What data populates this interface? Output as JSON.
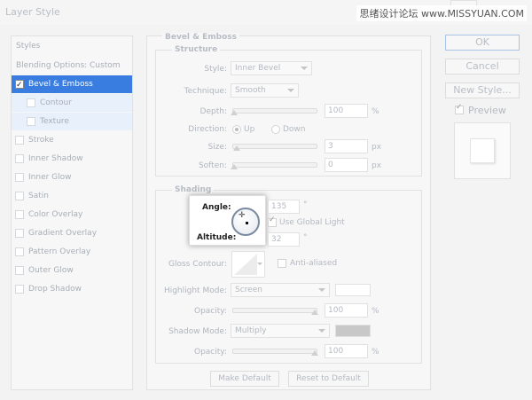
{
  "window": {
    "title": "Layer Style",
    "watermark": "思绪设计论坛 www.MISSYUAN.COM"
  },
  "styles_panel": {
    "items": [
      {
        "label": "Styles"
      },
      {
        "label": "Blending Options: Custom"
      },
      {
        "label": "Bevel & Emboss",
        "checked": true,
        "selected": true
      },
      {
        "label": "Contour"
      },
      {
        "label": "Texture"
      },
      {
        "label": "Stroke"
      },
      {
        "label": "Inner Shadow"
      },
      {
        "label": "Inner Glow"
      },
      {
        "label": "Satin"
      },
      {
        "label": "Color Overlay"
      },
      {
        "label": "Gradient Overlay"
      },
      {
        "label": "Pattern Overlay"
      },
      {
        "label": "Outer Glow"
      },
      {
        "label": "Drop Shadow"
      }
    ]
  },
  "bevel": {
    "title": "Bevel & Emboss",
    "structure": {
      "title": "Structure",
      "style_label": "Style:",
      "style_value": "Inner Bevel",
      "technique_label": "Technique:",
      "technique_value": "Smooth",
      "depth_label": "Depth:",
      "depth_value": "100",
      "depth_unit": "%",
      "direction_label": "Direction:",
      "direction_up": "Up",
      "direction_down": "Down",
      "size_label": "Size:",
      "size_value": "3",
      "size_unit": "px",
      "soften_label": "Soften:",
      "soften_value": "0",
      "soften_unit": "px"
    },
    "shading": {
      "title": "Shading",
      "angle_label": "Angle:",
      "angle_value": "135",
      "angle_unit": "°",
      "use_global_light": "Use Global Light",
      "altitude_label": "Altitude:",
      "altitude_value": "32",
      "altitude_unit": "°",
      "gloss_contour_label": "Gloss Contour:",
      "anti_aliased": "Anti-aliased",
      "highlight_mode_label": "Highlight Mode:",
      "highlight_mode_value": "Screen",
      "highlight_color": "#ffffff",
      "highlight_opacity_label": "Opacity:",
      "highlight_opacity_value": "100",
      "highlight_opacity_unit": "%",
      "shadow_mode_label": "Shadow Mode:",
      "shadow_mode_value": "Multiply",
      "shadow_color": "#c8c8c8",
      "shadow_opacity_label": "Opacity:",
      "shadow_opacity_value": "100",
      "shadow_opacity_unit": "%"
    },
    "make_default": "Make Default",
    "reset_default": "Reset to Default"
  },
  "buttons": {
    "ok": "OK",
    "cancel": "Cancel",
    "new_style": "New Style...",
    "preview": "Preview"
  }
}
